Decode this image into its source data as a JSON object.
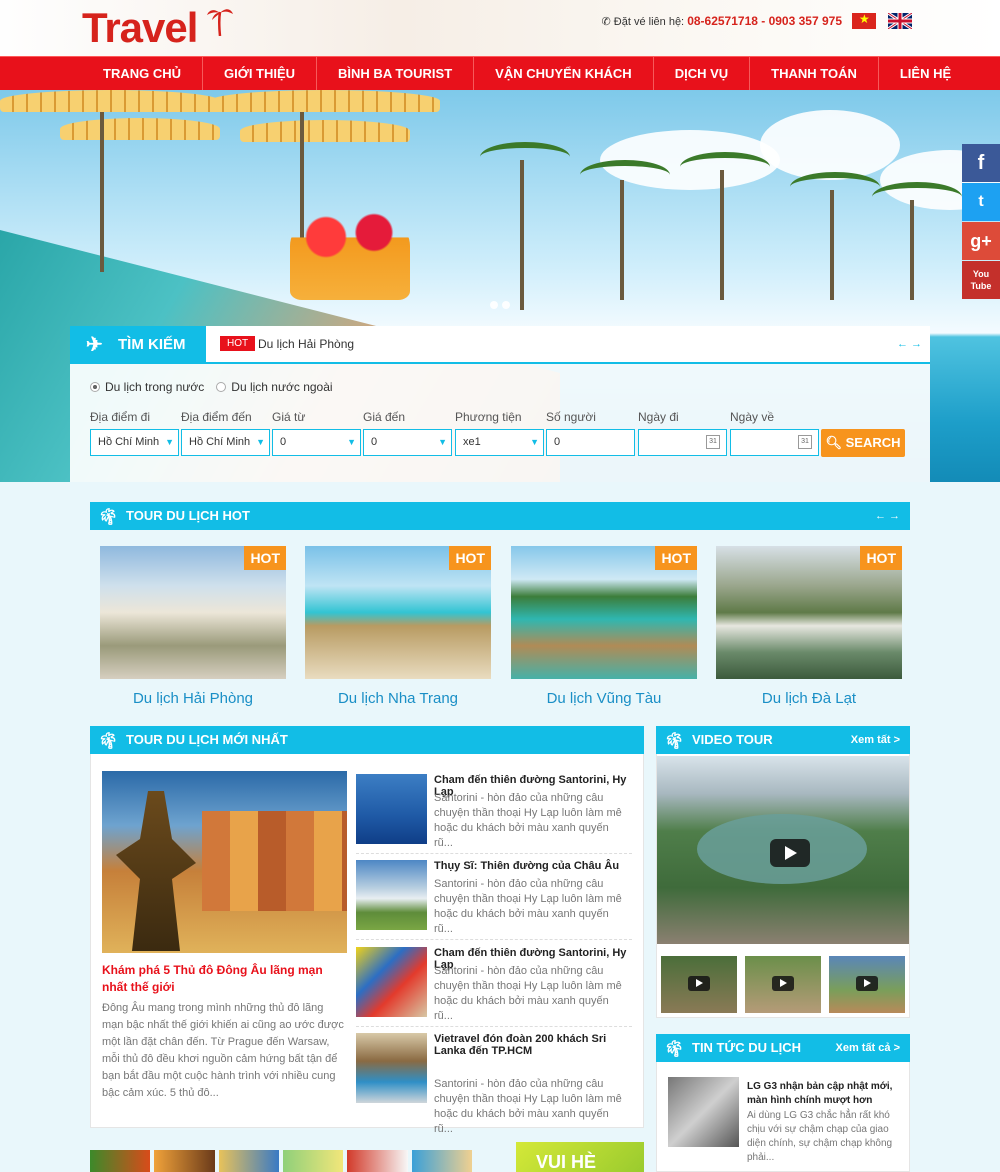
{
  "header": {
    "logo": "Travel",
    "contact_label": "Đặt vé liên hệ:",
    "phones": "08-62571718 - 0903 357 975"
  },
  "nav": [
    "TRANG CHỦ",
    "GIỚI THIỆU",
    "BÌNH BA TOURIST",
    "VẬN CHUYỂN KHÁCH",
    "DỊCH VỤ",
    "THANH TOÁN",
    "LIÊN HỆ"
  ],
  "social": [
    "f",
    "t",
    "g+",
    "You Tube"
  ],
  "search": {
    "tab": "TÌM KIẾM",
    "hot_badge": "HOT",
    "hot_text": "Du lịch Hải Phòng",
    "arrows": "← →",
    "radio_domestic": "Du lịch trong nước",
    "radio_foreign": "Du lịch nước ngoài",
    "fields": [
      {
        "label": "Địa điểm đi",
        "value": "Hồ Chí Minh"
      },
      {
        "label": "Địa điểm đến",
        "value": "Hồ Chí Minh"
      },
      {
        "label": "Giá từ",
        "value": "0"
      },
      {
        "label": "Giá đến",
        "value": "0"
      },
      {
        "label": "Phương tiện",
        "value": "xe1"
      },
      {
        "label": "Số người",
        "value": "0"
      },
      {
        "label": "Ngày đi",
        "value": ""
      },
      {
        "label": "Ngày về",
        "value": ""
      }
    ],
    "button": "SEARCH"
  },
  "hot_tours": {
    "title": "TOUR DU LỊCH HOT",
    "arrows": "← →",
    "badge": "HOT",
    "items": [
      "Du lịch Hải Phòng",
      "Du lịch Nha Trang",
      "Du lịch Vũng Tàu",
      "Du lịch Đà Lạt"
    ]
  },
  "latest": {
    "title": "TOUR DU LỊCH MỚI NHẤT",
    "feature_title": "Khám phá 5 Thủ đô Đông Âu lãng mạn nhất thế giới",
    "feature_desc": "Đông Âu mang trong mình những thủ đô lãng mạn bậc nhất thế giới khiến ai cũng ao ước được một lần đặt chân đến. Từ Prague đến Warsaw, mỗi thủ đô đều khơi nguồn cảm hứng bất tận để bạn bắt đầu một cuộc hành trình với nhiều cung bậc cảm xúc. 5 thủ đô...",
    "items": [
      {
        "title": "Cham đến thiên đường Santorini, Hy Lạp",
        "desc": "Santorini - hòn đảo của những câu chuyện thần thoại Hy Lạp luôn làm mê hoặc du khách bởi màu xanh quyến rũ..."
      },
      {
        "title": "Thụy Sĩ: Thiên đường của Châu Âu",
        "desc": "Santorini - hòn đảo của những câu chuyện thần thoại Hy Lạp luôn làm mê hoặc du khách bởi màu xanh quyến rũ..."
      },
      {
        "title": "Cham đến thiên đường Santorini, Hy Lạp",
        "desc": "Santorini - hòn đảo của những câu chuyện thần thoại Hy Lạp luôn làm mê hoặc du khách bởi màu xanh quyến rũ..."
      },
      {
        "title": "Vietravel đón đoàn 200 khách Sri Lanka đến TP.HCM",
        "desc": "Santorini - hòn đảo của những câu chuyện thần thoại Hy Lạp luôn làm mê hoặc du khách bởi màu xanh quyến rũ..."
      }
    ]
  },
  "video": {
    "title": "VIDEO TOUR",
    "more": "Xem tất >"
  },
  "news": {
    "title": "TIN TỨC DU LỊCH",
    "more": "Xem tất cả >",
    "item_title": "LG G3 nhận bản cập nhật mới, màn hình chính mượt hơn",
    "item_desc": "Ai dùng LG G3 chắc hẳn rất khó chịu với sự chậm chạp của giao diện chính, sự chậm chạp không phải..."
  },
  "banner": {
    "text": "VUI HÈ"
  },
  "colors": {
    "red": "#e8111b",
    "cyan": "#12bde6",
    "orange": "#f7941d",
    "link": "#1a8fc6"
  }
}
